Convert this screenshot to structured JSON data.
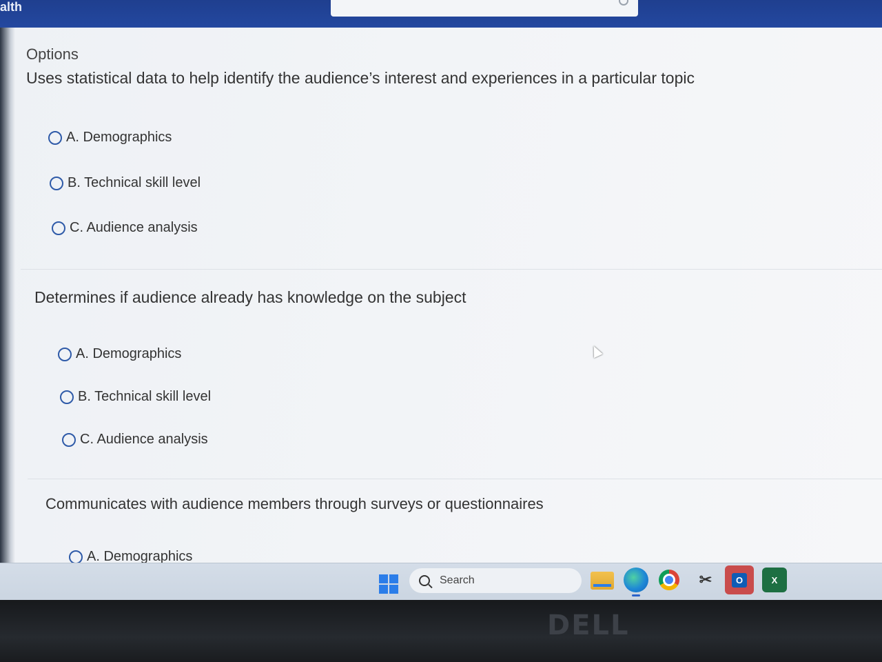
{
  "header": {
    "app_title_fragment": "alth",
    "search_value": ""
  },
  "section_label": "Options",
  "questions": [
    {
      "text": "Uses statistical data to help identify the audience’s interest and experiences in a particular topic",
      "options": [
        "A. Demographics",
        "B. Technical skill level",
        "C. Audience analysis"
      ]
    },
    {
      "text": "Determines if audience already has knowledge on the subject",
      "options": [
        "A. Demographics",
        "B. Technical skill level",
        "C. Audience analysis"
      ]
    },
    {
      "text": "Communicates with audience members through surveys or questionnaires",
      "options": [
        "A. Demographics"
      ]
    }
  ],
  "taskbar": {
    "search_placeholder": "Search",
    "apps": [
      "file-explorer",
      "edge",
      "chrome",
      "snipping-tool",
      "outlook",
      "excel"
    ],
    "outlook_letter": "O",
    "excel_letter": "X"
  },
  "device_brand": "DELL",
  "colors": {
    "accent": "#2e5aa8",
    "header": "#23479e",
    "windows_blue": "#2b7de9"
  }
}
